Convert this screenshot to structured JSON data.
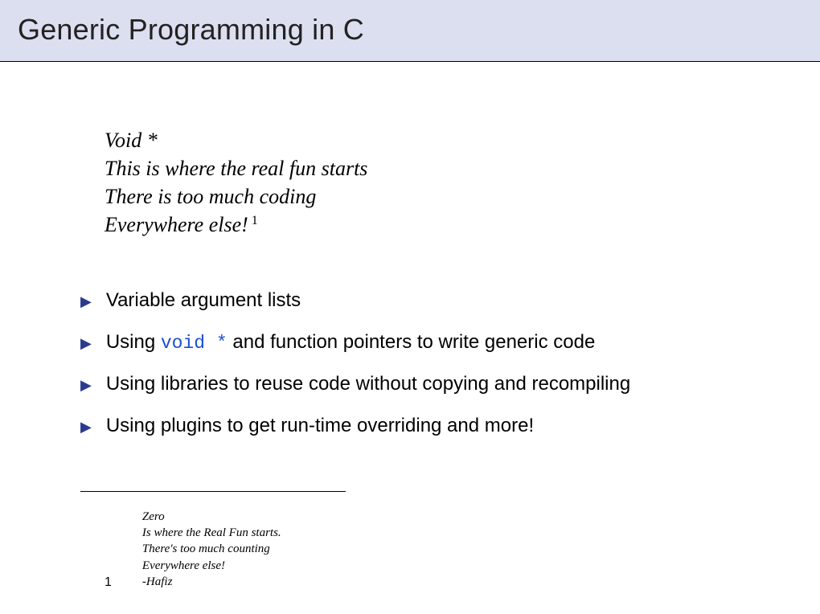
{
  "title": "Generic Programming in C",
  "quote": {
    "line1": "Void *",
    "line2": "This is where the real fun starts",
    "line3": "There is too much coding",
    "line4": "Everywhere else!",
    "footnote_ref": "1"
  },
  "bullets": [
    {
      "text_before": "Variable argument lists",
      "code": "",
      "text_after": ""
    },
    {
      "text_before": "Using ",
      "code": "void *",
      "text_after": " and function pointers to write generic code"
    },
    {
      "text_before": "Using libraries to reuse code without copying and recompiling",
      "code": "",
      "text_after": ""
    },
    {
      "text_before": "Using plugins to get run-time overriding and more!",
      "code": "",
      "text_after": ""
    }
  ],
  "footnote": {
    "number": "1",
    "line1": "Zero",
    "line2": "Is where the Real Fun starts.",
    "line3": "There's too much counting",
    "line4": "Everywhere else!",
    "line5": "-Hafiz"
  }
}
